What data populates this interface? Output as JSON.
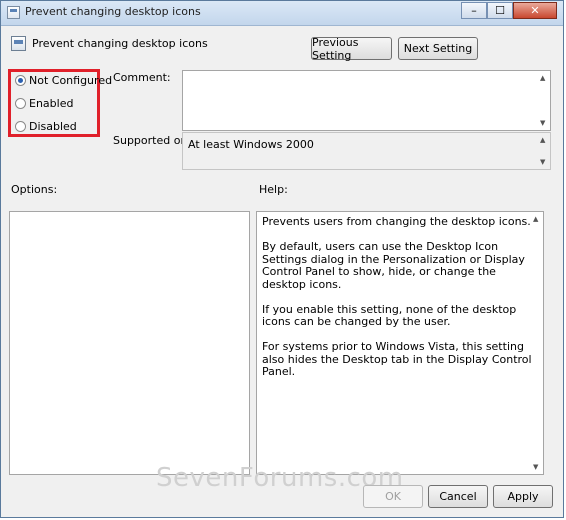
{
  "window": {
    "title": "Prevent changing desktop icons",
    "min": "–",
    "max": "☐",
    "close": "✕"
  },
  "header": {
    "title": "Prevent changing desktop icons"
  },
  "nav": {
    "previous": "Previous Setting",
    "next": "Next Setting"
  },
  "state": {
    "selected": "not_configured",
    "options": [
      {
        "key": "not_configured",
        "label": "Not Configured"
      },
      {
        "key": "enabled",
        "label": "Enabled"
      },
      {
        "key": "disabled",
        "label": "Disabled"
      }
    ]
  },
  "comment": {
    "label": "Comment:",
    "value": ""
  },
  "supported": {
    "label": "Supported on:",
    "value": "At least Windows 2000"
  },
  "options_panel": {
    "label": "Options:"
  },
  "help": {
    "label": "Help:",
    "paragraphs": [
      "Prevents users from changing the desktop icons.",
      "By default, users can use the Desktop Icon Settings dialog in the Personalization or Display Control Panel to show, hide, or change the desktop icons.",
      "If you enable this setting, none of the desktop icons can be changed by the user.",
      "For systems prior to Windows Vista, this setting also hides the Desktop tab in the Display Control Panel."
    ]
  },
  "footer": {
    "ok": "OK",
    "cancel": "Cancel",
    "apply": "Apply"
  },
  "watermark": "SevenForums.com",
  "colors": {
    "highlight_border": "#e0202a",
    "radio_selected": "#2a5fb0"
  }
}
